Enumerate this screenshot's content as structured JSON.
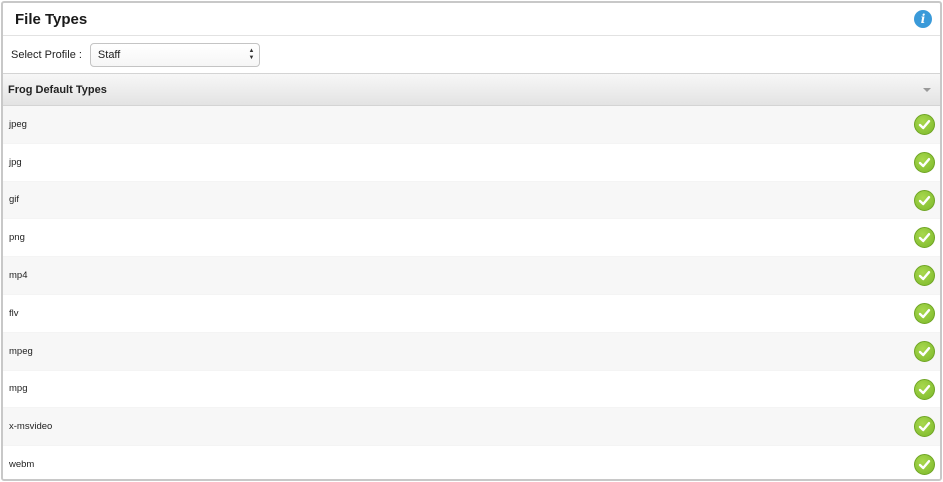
{
  "header": {
    "title": "File Types",
    "info_icon": "info-icon"
  },
  "profile": {
    "label": "Select Profile :",
    "selected": "Staff"
  },
  "section": {
    "title": "Frog Default Types"
  },
  "colors": {
    "check_green": "#8cc63f",
    "info_blue": "#3a9ad9"
  },
  "file_types": [
    {
      "name": "jpeg",
      "enabled": true
    },
    {
      "name": "jpg",
      "enabled": true
    },
    {
      "name": "gif",
      "enabled": true
    },
    {
      "name": "png",
      "enabled": true
    },
    {
      "name": "mp4",
      "enabled": true
    },
    {
      "name": "flv",
      "enabled": true
    },
    {
      "name": "mpeg",
      "enabled": true
    },
    {
      "name": "mpg",
      "enabled": true
    },
    {
      "name": "x-msvideo",
      "enabled": true
    },
    {
      "name": "webm",
      "enabled": true
    }
  ]
}
